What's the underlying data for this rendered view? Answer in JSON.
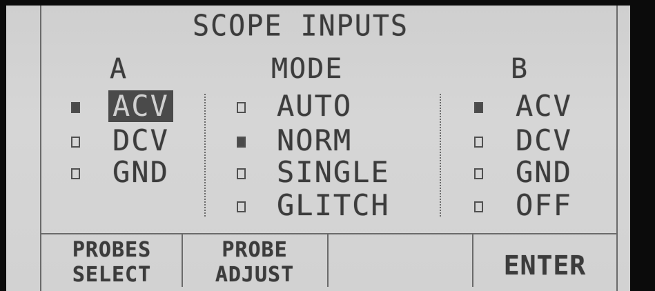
{
  "screen": {
    "title": "SCOPE INPUTS"
  },
  "channel_a": {
    "heading": "A",
    "options": [
      {
        "label": "ACV",
        "checked": true,
        "highlighted": true
      },
      {
        "label": "DCV",
        "checked": false,
        "highlighted": false
      },
      {
        "label": "GND",
        "checked": false,
        "highlighted": false
      }
    ]
  },
  "mode": {
    "heading": "MODE",
    "options": [
      {
        "label": "AUTO",
        "checked": false
      },
      {
        "label": "NORM",
        "checked": true
      },
      {
        "label": "SINGLE",
        "checked": false
      },
      {
        "label": "GLITCH",
        "checked": false
      }
    ]
  },
  "channel_b": {
    "heading": "B",
    "options": [
      {
        "label": "ACV",
        "checked": true
      },
      {
        "label": "DCV",
        "checked": false
      },
      {
        "label": "GND",
        "checked": false
      },
      {
        "label": "OFF",
        "checked": false
      }
    ]
  },
  "softkeys": [
    {
      "line1": "PROBES",
      "line2": "SELECT"
    },
    {
      "line1": "PROBE",
      "line2": "ADJUST"
    },
    {
      "line1": "",
      "line2": ""
    },
    {
      "line1": "ENTER",
      "line2": ""
    }
  ],
  "colors": {
    "lcd_background": "#d2d2d2",
    "lcd_text": "#3c3c3c",
    "bezel": "#0b0b0b"
  }
}
